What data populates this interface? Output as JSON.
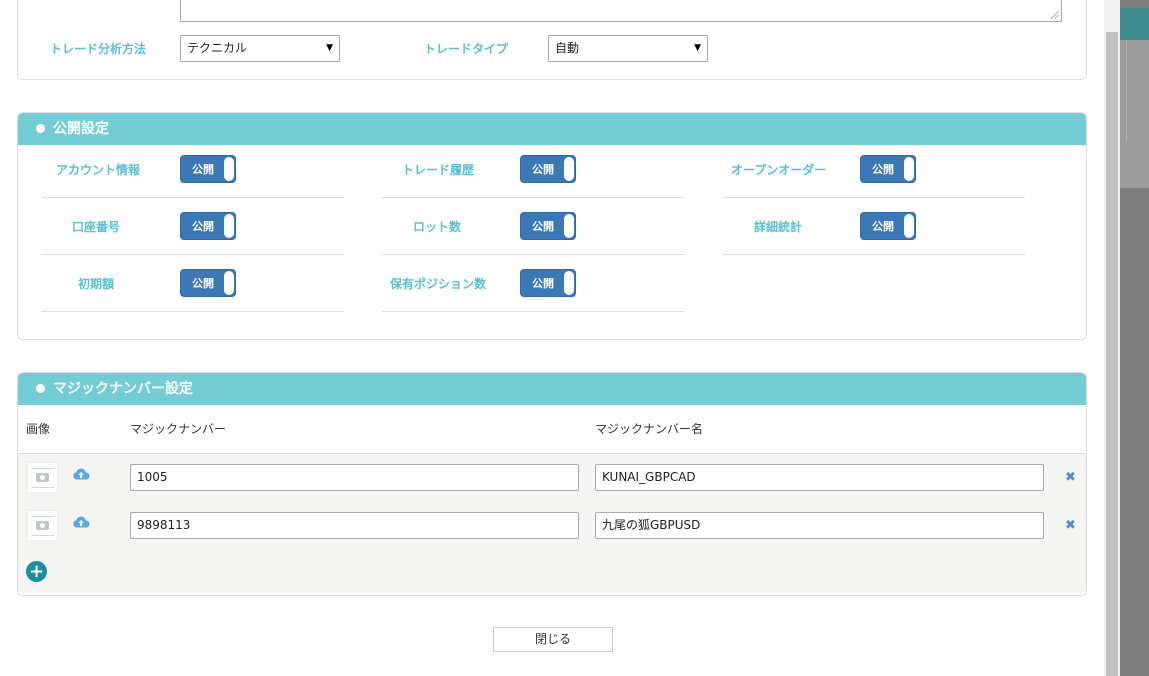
{
  "trade_form": {
    "analysis_label": "トレード分析方法",
    "analysis_value": "テクニカル",
    "type_label": "トレードタイプ",
    "type_value": "自動"
  },
  "public_settings": {
    "title": "公開設定",
    "toggle_label": "公開",
    "items": [
      {
        "label": "アカウント情報"
      },
      {
        "label": "トレード履歴"
      },
      {
        "label": "オープンオーダー"
      },
      {
        "label": "口座番号"
      },
      {
        "label": "ロット数"
      },
      {
        "label": "詳細統計"
      },
      {
        "label": "初期額"
      },
      {
        "label": "保有ポジション数"
      }
    ]
  },
  "magic_settings": {
    "title": "マジックナンバー設定",
    "columns": {
      "image": "画像",
      "number": "マジックナンバー",
      "name": "マジックナンバー名"
    },
    "rows": [
      {
        "number": "1005",
        "name": "KUNAI_GBPCAD"
      },
      {
        "number": "9898113",
        "name": "九尾の狐GBPUSD"
      }
    ],
    "delete_glyph": "✖",
    "add_glyph": "+"
  },
  "footer": {
    "close_label": "閉じる"
  },
  "colors": {
    "accent": "#74cdd4",
    "label": "#5cc0d0",
    "toggle": "#3c78b6",
    "add_button": "#17929c"
  }
}
